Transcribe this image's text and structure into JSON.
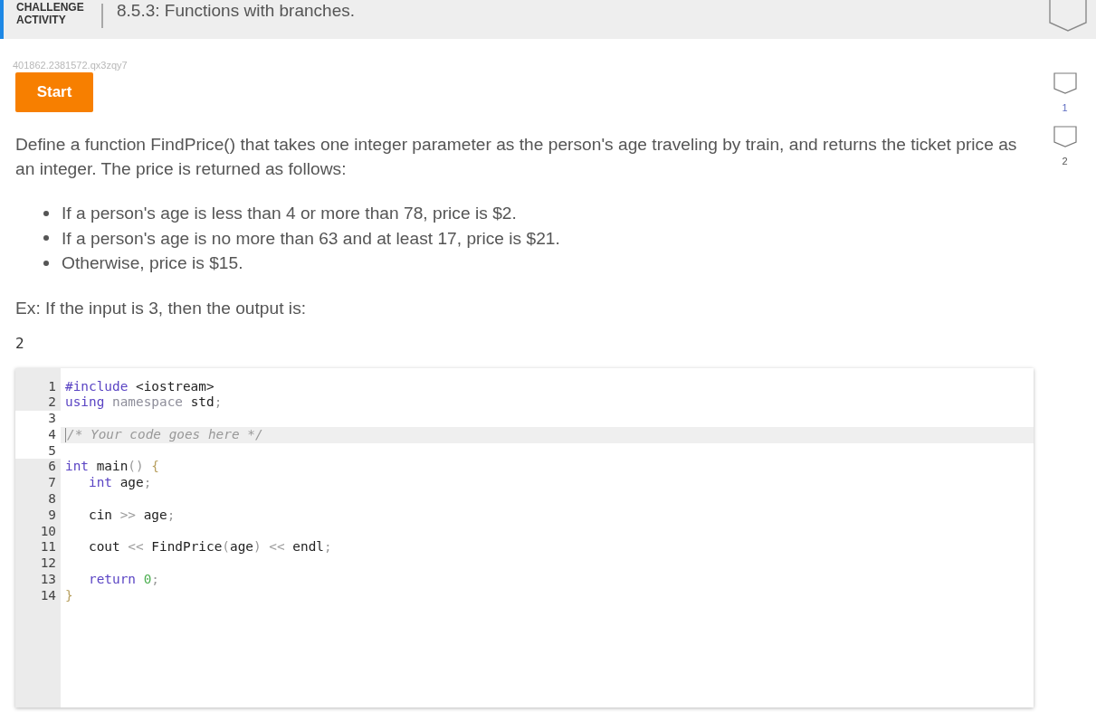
{
  "header": {
    "label": "CHALLENGE ACTIVITY",
    "title": "8.5.3: Functions with branches."
  },
  "activity_id": "401862.2381572.qx3zqy7",
  "start_button": {
    "label": "Start"
  },
  "levels": [
    {
      "label": "1",
      "selected": true
    },
    {
      "label": "2",
      "selected": false
    }
  ],
  "prompt": {
    "intro": "Define a function FindPrice() that takes one integer parameter as the person's age traveling by train, and returns the ticket price as an integer. The price is returned as follows:",
    "bullets": [
      "If a person's age is less than 4 or more than 78, price is $2.",
      "If a person's age is no more than 63 and at least 17, price is $21.",
      "Otherwise, price is $15."
    ],
    "example": "Ex: If the input is 3, then the output is:",
    "example_output": "2"
  },
  "editor": {
    "lines": [
      {
        "number": "1",
        "editable": false,
        "active": false,
        "tokens": [
          {
            "kind": "kw",
            "text": "#include"
          },
          {
            "kind": "text",
            "text": " <iostream>"
          }
        ]
      },
      {
        "number": "2",
        "editable": false,
        "active": false,
        "tokens": [
          {
            "kind": "kw",
            "text": "using"
          },
          {
            "kind": "muted",
            "text": " namespace"
          },
          {
            "kind": "text",
            "text": " std"
          },
          {
            "kind": "punct",
            "text": ";"
          }
        ]
      },
      {
        "number": "3",
        "editable": true,
        "active": false
      },
      {
        "number": "4",
        "editable": true,
        "active": true,
        "tokens": [
          {
            "kind": "comment",
            "text": "/* Your code goes here */"
          }
        ]
      },
      {
        "number": "5",
        "editable": true,
        "active": false
      },
      {
        "number": "6",
        "editable": false,
        "active": false,
        "tokens": [
          {
            "kind": "kw",
            "text": "int"
          },
          {
            "kind": "text",
            "text": " main"
          },
          {
            "kind": "punct",
            "text": "()"
          },
          {
            "kind": "brace",
            "text": " {"
          }
        ]
      },
      {
        "number": "7",
        "editable": false,
        "active": false,
        "tokens": [
          {
            "kind": "kw",
            "text": "   int"
          },
          {
            "kind": "text",
            "text": " age"
          },
          {
            "kind": "punct",
            "text": ";"
          }
        ]
      },
      {
        "number": "8",
        "editable": false,
        "active": false
      },
      {
        "number": "9",
        "editable": false,
        "active": false,
        "tokens": [
          {
            "kind": "text",
            "text": "   cin"
          },
          {
            "kind": "punct",
            "text": " >>"
          },
          {
            "kind": "text",
            "text": " age"
          },
          {
            "kind": "punct",
            "text": ";"
          }
        ]
      },
      {
        "number": "10",
        "editable": false,
        "active": false
      },
      {
        "number": "11",
        "editable": false,
        "active": false,
        "tokens": [
          {
            "kind": "text",
            "text": "   cout"
          },
          {
            "kind": "punct",
            "text": " <<"
          },
          {
            "kind": "text",
            "text": " FindPrice"
          },
          {
            "kind": "punct",
            "text": "("
          },
          {
            "kind": "text",
            "text": "age"
          },
          {
            "kind": "punct",
            "text": ")"
          },
          {
            "kind": "punct",
            "text": " <<"
          },
          {
            "kind": "text",
            "text": " endl"
          },
          {
            "kind": "punct",
            "text": ";"
          }
        ]
      },
      {
        "number": "12",
        "editable": false,
        "active": false
      },
      {
        "number": "13",
        "editable": false,
        "active": false,
        "tokens": [
          {
            "kind": "kw",
            "text": "   return"
          },
          {
            "kind": "num",
            "text": " 0"
          },
          {
            "kind": "punct",
            "text": ";"
          }
        ]
      },
      {
        "number": "14",
        "editable": false,
        "active": false,
        "tokens": [
          {
            "kind": "brace",
            "text": "}"
          }
        ]
      }
    ]
  }
}
